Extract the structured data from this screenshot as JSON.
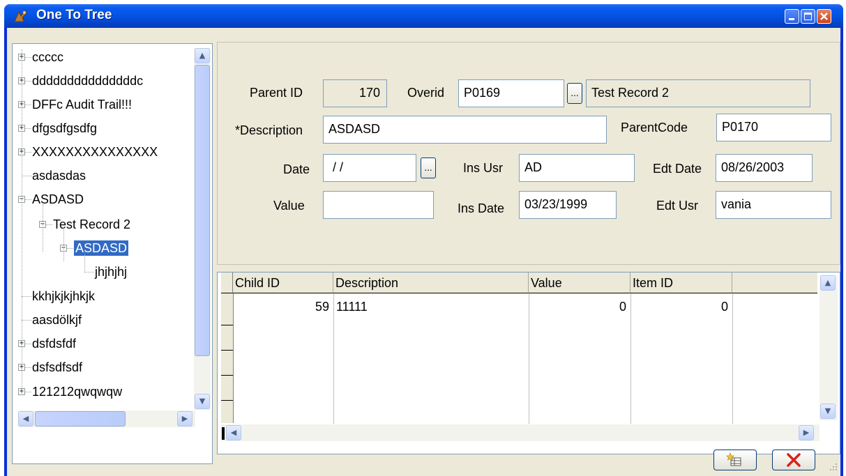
{
  "window": {
    "title": "One To Tree"
  },
  "tree": {
    "items": [
      {
        "label": "ccccc",
        "expander": "+"
      },
      {
        "label": "dddddddddddddddc",
        "expander": "+"
      },
      {
        "label": "DFFc Audit Trail!!!",
        "expander": "+"
      },
      {
        "label": "dfgsdfgsdfg",
        "expander": "+"
      },
      {
        "label": "XXXXXXXXXXXXXXX",
        "expander": "+"
      },
      {
        "label": "asdasdas",
        "expander": ""
      },
      {
        "label": "ASDASD",
        "expander": "-"
      },
      {
        "label": "Test Record 2",
        "expander": "-"
      },
      {
        "label": "ASDASD",
        "expander": "-"
      },
      {
        "label": "jhjhjhj",
        "expander": ""
      },
      {
        "label": "kkhjkjkjhkjk",
        "expander": ""
      },
      {
        "label": "aasdölkjf",
        "expander": ""
      },
      {
        "label": "dsfdsfdf",
        "expander": "+"
      },
      {
        "label": "dsfsdfsdf",
        "expander": "+"
      },
      {
        "label": "121212qwqwqw",
        "expander": "+"
      }
    ]
  },
  "form": {
    "parent_id_label": "Parent ID",
    "parent_id_value": "170",
    "overid_label": "Overid",
    "overid_value": "P0169",
    "overid_desc": "Test Record 2",
    "description_label": "*Description",
    "description_value": "ASDASD",
    "parentcode_label": "ParentCode",
    "parentcode_value": "P0170",
    "date_label": "Date",
    "date_value": " / /",
    "ins_usr_label": "Ins Usr",
    "ins_usr_value": "AD",
    "edt_date_label": "Edt Date",
    "edt_date_value": "08/26/2003",
    "value_label": "Value",
    "value_value": "",
    "ins_date_label": "Ins Date",
    "ins_date_value": "03/23/1999",
    "edt_usr_label": "Edt Usr",
    "edt_usr_value": "vania",
    "lookup_button": "..."
  },
  "grid": {
    "columns": [
      "Child ID",
      "Description",
      "Value",
      "Item ID"
    ],
    "rows": [
      {
        "child_id": "59",
        "description": "11111",
        "value": "0",
        "item_id": "0"
      }
    ]
  },
  "colors": {
    "titlebar": "#0453e3",
    "selection": "#316ac5",
    "face": "#ece9d8"
  }
}
